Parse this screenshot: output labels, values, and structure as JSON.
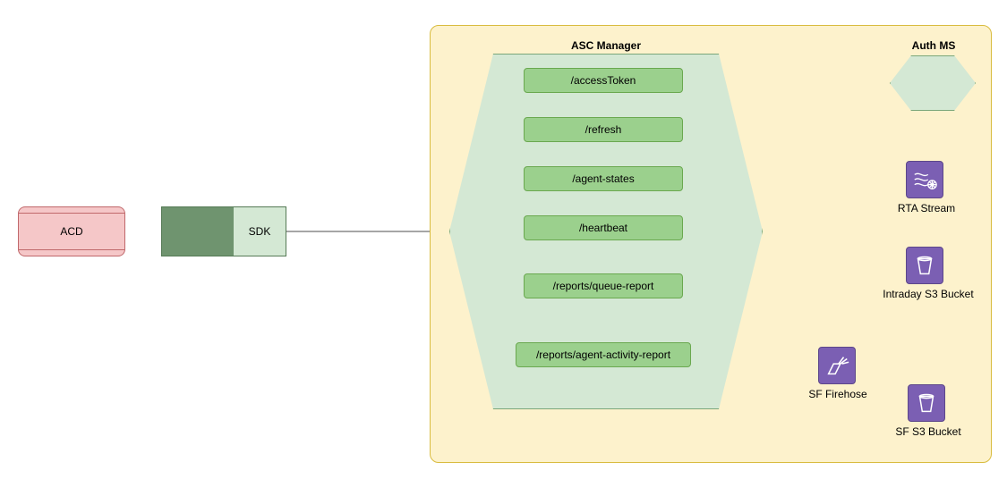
{
  "nodes": {
    "acd": "ACD",
    "sdk": "SDK"
  },
  "container": {
    "title": "ASC Manager",
    "endpoints": [
      "/accessToken",
      "/refresh",
      "/agent-states",
      "/heartbeat",
      "/reports/queue-report",
      "/reports/agent-activity-report"
    ]
  },
  "services": {
    "auth": "Auth MS",
    "rta": "RTA Stream",
    "intraday": "Intraday S3 Bucket",
    "firehose": "SF Firehose",
    "sfbucket": "SF S3 Bucket"
  }
}
